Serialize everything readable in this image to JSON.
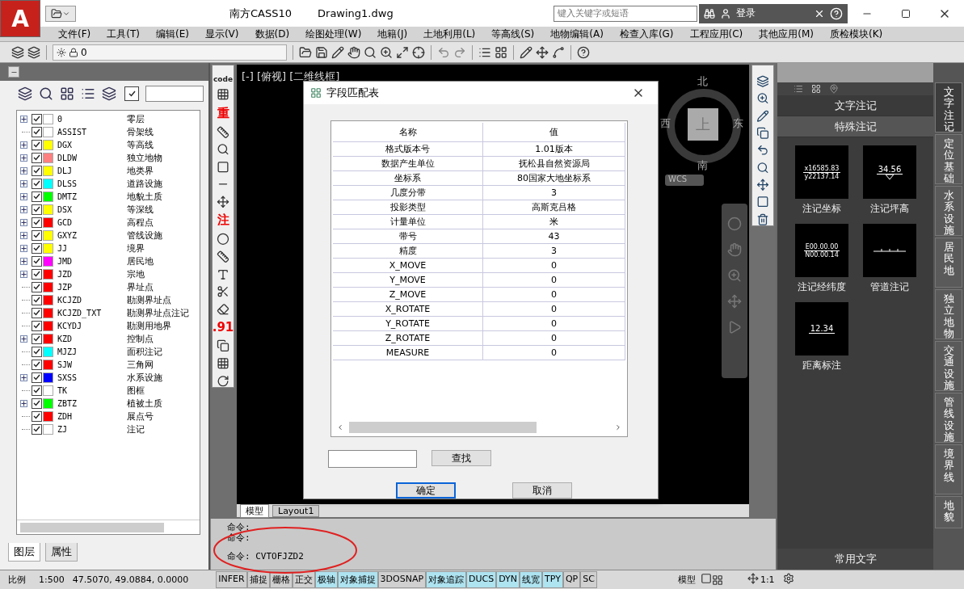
{
  "app": {
    "logo": "A",
    "title": "南方CASS10",
    "file": "Drawing1.dwg",
    "search_placeholder": "键入关键字或短语",
    "login": "登录"
  },
  "menu": [
    "文件(F)",
    "工具(T)",
    "编辑(E)",
    "显示(V)",
    "数据(D)",
    "绘图处理(W)",
    "地籍(J)",
    "土地利用(L)",
    "等高线(S)",
    "地物编辑(A)",
    "检查入库(G)",
    "工程应用(C)",
    "其他应用(M)",
    "质检模块(K)"
  ],
  "toolbar": {
    "layer_value": "0"
  },
  "layer_panel": {
    "layers": [
      {
        "name": "0",
        "description": "零层",
        "color": "#ffffff",
        "checked": true,
        "expandable": true
      },
      {
        "name": "ASSIST",
        "description": "骨架线",
        "color": "#ffffff",
        "checked": true,
        "expandable": false
      },
      {
        "name": "DGX",
        "description": "等高线",
        "color": "#ffff00",
        "checked": true,
        "expandable": true
      },
      {
        "name": "DLDW",
        "description": "独立地物",
        "color": "#ff8080",
        "checked": true,
        "expandable": true
      },
      {
        "name": "DLJ",
        "description": "地类界",
        "color": "#ffff00",
        "checked": true,
        "expandable": true
      },
      {
        "name": "DLSS",
        "description": "道路设施",
        "color": "#00ffff",
        "checked": true,
        "expandable": true
      },
      {
        "name": "DMTZ",
        "description": "地貌土质",
        "color": "#00ff00",
        "checked": true,
        "expandable": true
      },
      {
        "name": "DSX",
        "description": "等深线",
        "color": "#ffff00",
        "checked": true,
        "expandable": true
      },
      {
        "name": "GCD",
        "description": "高程点",
        "color": "#ff0000",
        "checked": true,
        "expandable": true
      },
      {
        "name": "GXYZ",
        "description": "管线设施",
        "color": "#ffff00",
        "checked": true,
        "expandable": true
      },
      {
        "name": "JJ",
        "description": "境界",
        "color": "#ffff00",
        "checked": true,
        "expandable": true
      },
      {
        "name": "JMD",
        "description": "居民地",
        "color": "#ff00ff",
        "checked": true,
        "expandable": true
      },
      {
        "name": "JZD",
        "description": "宗地",
        "color": "#ff0000",
        "checked": true,
        "expandable": true
      },
      {
        "name": "JZP",
        "description": "界址点",
        "color": "#ff0000",
        "checked": true,
        "expandable": false
      },
      {
        "name": "KCJZD",
        "description": "勘测界址点",
        "color": "#ff0000",
        "checked": true,
        "expandable": false
      },
      {
        "name": "KCJZD_TXT",
        "description": "勘测界址点注记",
        "color": "#ff0000",
        "checked": true,
        "expandable": false
      },
      {
        "name": "KCYDJ",
        "description": "勘测用地界",
        "color": "#ff0000",
        "checked": true,
        "expandable": false
      },
      {
        "name": "KZD",
        "description": "控制点",
        "color": "#ff0000",
        "checked": true,
        "expandable": true
      },
      {
        "name": "MJZJ",
        "description": "面积注记",
        "color": "#00ffff",
        "checked": true,
        "expandable": false
      },
      {
        "name": "SJW",
        "description": "三角网",
        "color": "#ff0000",
        "checked": true,
        "expandable": false
      },
      {
        "name": "SXSS",
        "description": "水系设施",
        "color": "#0000ff",
        "checked": true,
        "expandable": true
      },
      {
        "name": "TK",
        "description": "图框",
        "color": "#ffffff",
        "checked": true,
        "expandable": false
      },
      {
        "name": "ZBTZ",
        "description": "植被土质",
        "color": "#00ff00",
        "checked": true,
        "expandable": true
      },
      {
        "name": "ZDH",
        "description": "展点号",
        "color": "#ff0000",
        "checked": true,
        "expandable": false
      },
      {
        "name": "ZJ",
        "description": "注记",
        "color": "#ffffff",
        "checked": true,
        "expandable": false
      }
    ],
    "tabs": [
      {
        "label": "图层",
        "selected": true
      },
      {
        "label": "属性",
        "selected": false
      }
    ]
  },
  "left_toolbar": [
    {
      "kind": "text",
      "label": "code",
      "red": false
    },
    {
      "kind": "icon"
    },
    {
      "kind": "text",
      "label": "重",
      "red": true
    },
    {
      "kind": "icon"
    },
    {
      "kind": "icon"
    },
    {
      "kind": "icon"
    },
    {
      "kind": "icon"
    },
    {
      "kind": "icon"
    },
    {
      "kind": "text",
      "label": "注",
      "red": true
    },
    {
      "kind": "icon"
    },
    {
      "kind": "icon"
    },
    {
      "kind": "icon"
    },
    {
      "kind": "icon"
    },
    {
      "kind": "icon"
    },
    {
      "kind": "text",
      "label": ".91",
      "red": true
    },
    {
      "kind": "icon"
    },
    {
      "kind": "icon"
    },
    {
      "kind": "icon"
    }
  ],
  "viewport": {
    "label": "[-] [俯视] [二维线框]",
    "compass": {
      "north": "北",
      "south": "南",
      "east": "东",
      "west": "西",
      "top": "上"
    },
    "ucs": "WCS",
    "tabs": [
      {
        "label": "模型",
        "selected": true
      },
      {
        "label": "Layout1",
        "selected": false
      }
    ]
  },
  "dialog": {
    "title": "字段匹配表",
    "columns": [
      "名称",
      "值"
    ],
    "rows": [
      [
        "格式版本号",
        "1.01版本"
      ],
      [
        "数据产生单位",
        "抚松县自然资源局"
      ],
      [
        "坐标系",
        "80国家大地坐标系"
      ],
      [
        "几度分带",
        "3"
      ],
      [
        "投影类型",
        "高斯克吕格"
      ],
      [
        "计量单位",
        "米"
      ],
      [
        "带号",
        "43"
      ],
      [
        "精度",
        "3"
      ],
      [
        "X_MOVE",
        "0"
      ],
      [
        "Y_MOVE",
        "0"
      ],
      [
        "Z_MOVE",
        "0"
      ],
      [
        "X_ROTATE",
        "0"
      ],
      [
        "Y_ROTATE",
        "0"
      ],
      [
        "Z_ROTATE",
        "0"
      ],
      [
        "MEASURE",
        "0"
      ]
    ],
    "find_button": "查找",
    "ok_button": "确定",
    "cancel_button": "取消"
  },
  "palette": {
    "sections": [
      {
        "label": "文字注记",
        "expanded": false
      },
      {
        "label": "特殊注记",
        "expanded": true
      }
    ],
    "items": [
      {
        "kind": "coordinate",
        "label": "注记坐标",
        "lines": [
          "x16585.83",
          "y22137.14"
        ]
      },
      {
        "kind": "elevation",
        "label": "注记坪高",
        "lines": [
          "34.56"
        ]
      },
      {
        "kind": "coordinate",
        "label": "注记经纬度",
        "lines": [
          "E00.00.00",
          "N00.00.14"
        ]
      },
      {
        "kind": "pipe",
        "label": "管道注记"
      },
      {
        "kind": "distance",
        "label": "距离标注",
        "lines": [
          "12.34"
        ]
      }
    ],
    "footer": "常用文字",
    "tabs": [
      {
        "label": "文字注记",
        "selected": true
      },
      {
        "label": "定位基础",
        "selected": false
      },
      {
        "label": "水系设施",
        "selected": false
      },
      {
        "label": "居民地",
        "selected": false
      },
      {
        "label": "独立地物",
        "selected": false
      },
      {
        "label": "交通设施",
        "selected": false
      },
      {
        "label": "管线设施",
        "selected": false
      },
      {
        "label": "境界线",
        "selected": false
      },
      {
        "label": "地貌",
        "selected": false
      }
    ]
  },
  "command": {
    "lines": [
      "命令:",
      "命令:",
      "命令: CVTOFJZD2"
    ]
  },
  "status": {
    "scale_label": "比例",
    "scale": "1:500",
    "coordinates": "47.5070, 49.0884, 0.0000",
    "toggles": [
      {
        "label": "INFER",
        "on": false
      },
      {
        "label": "捕捉",
        "on": false
      },
      {
        "label": "栅格",
        "on": false
      },
      {
        "label": "正交",
        "on": false
      },
      {
        "label": "极轴",
        "on": true
      },
      {
        "label": "对象捕捉",
        "on": true
      },
      {
        "label": "3DOSNAP",
        "on": false
      },
      {
        "label": "对象追踪",
        "on": true
      },
      {
        "label": "DUCS",
        "on": true
      },
      {
        "label": "DYN",
        "on": true
      },
      {
        "label": "线宽",
        "on": true
      },
      {
        "label": "TPY",
        "on": true
      },
      {
        "label": "QP",
        "on": false
      },
      {
        "label": "SC",
        "on": false
      }
    ],
    "model": "模型",
    "annotation_scale": "1:1"
  }
}
